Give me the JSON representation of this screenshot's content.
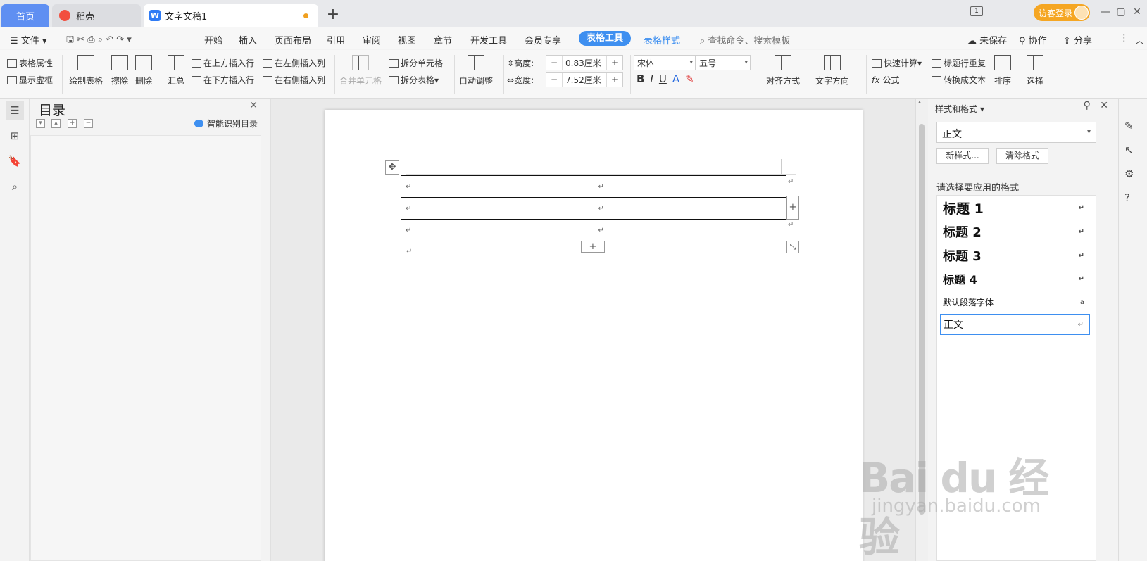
{
  "tabs": {
    "home": "首页",
    "daoke": "稻壳",
    "doc": "文字文稿1",
    "new": "+"
  },
  "login": "访客登录",
  "window_controls": [
    "—",
    "▢",
    "✕"
  ],
  "menu": {
    "file": "文件",
    "items": [
      "开始",
      "插入",
      "页面布局",
      "引用",
      "审阅",
      "视图",
      "章节",
      "开发工具",
      "会员专享"
    ],
    "table_tool": "表格工具",
    "table_style": "表格样式",
    "search": "查找命令、搜索模板",
    "unsaved": "未保存",
    "collab": "协作",
    "share": "分享"
  },
  "ribbon": {
    "table_props": "表格属性",
    "show_gridlines": "显示虚框",
    "draw_table": "绘制表格",
    "erase": "擦除",
    "delete": "删除",
    "summary": "汇总",
    "insert_above": "在上方插入行",
    "insert_below": "在下方插入行",
    "insert_left": "在左侧插入列",
    "insert_right": "在右侧插入列",
    "merge_cells": "合并单元格",
    "split_cell": "拆分单元格",
    "split_table": "拆分表格",
    "auto_fit": "自动调整",
    "height_label": "高度:",
    "height_value": "0.83厘米",
    "width_label": "宽度:",
    "width_value": "7.52厘米",
    "font": "宋体",
    "size": "五号",
    "align": "对齐方式",
    "text_dir": "文字方向",
    "quick_calc": "快速计算",
    "formula": "公式",
    "repeat_header": "标题行重复",
    "to_text": "转换成文本",
    "sort": "排序",
    "select": "选择"
  },
  "toc": {
    "title": "目录",
    "smart": "智能识别目录"
  },
  "doc": {
    "cell_mark": "↵",
    "rows": 3,
    "cols": 2
  },
  "styles_panel": {
    "title": "样式和格式",
    "current": "正文",
    "new_style": "新样式...",
    "clear_format": "清除格式",
    "subtitle": "请选择要应用的格式",
    "items": [
      {
        "label": "标题 1",
        "mark": "↵"
      },
      {
        "label": "标题 2",
        "mark": "↵"
      },
      {
        "label": "标题 3",
        "mark": "↵"
      },
      {
        "label": "标题 4",
        "mark": "↵"
      },
      {
        "label": "默认段落字体",
        "mark": "a"
      },
      {
        "label": "正文",
        "mark": "↵"
      }
    ]
  },
  "watermark": {
    "brand": "Bai du 经验",
    "url": "jingyan.baidu.com"
  },
  "colors": {
    "accent": "#3e8ff0",
    "home_tab": "#5f8ff2",
    "login": "#f5a623"
  }
}
